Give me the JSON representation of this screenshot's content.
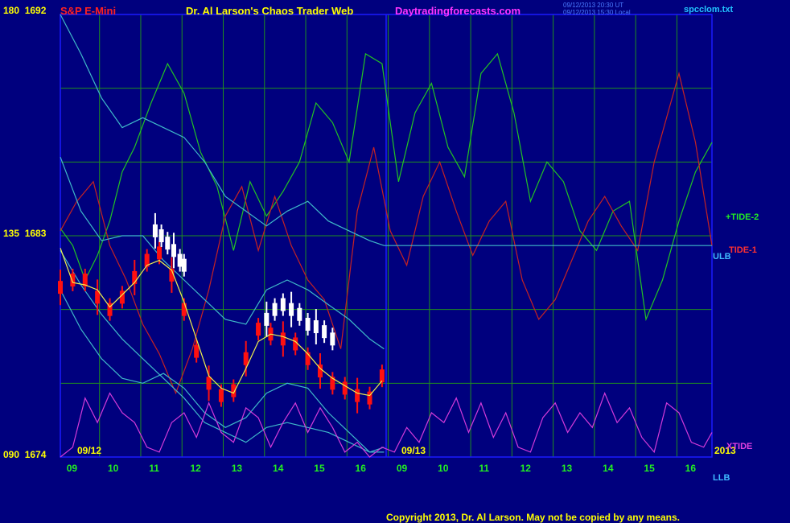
{
  "header": {
    "instrument": "S&P E-Mini",
    "title": "Dr. Al Larson's Chaos Trader Web",
    "site": "Daytradingforecasts.com",
    "stamp_line1": "09/12/2013 20:30 UT",
    "stamp_line2": "09/12/2013 15:30 Local",
    "file": "spcclom.txt"
  },
  "footer": {
    "copyright": "Copyright 2013, Dr. Al Larson. May not be copied by any means."
  },
  "colors": {
    "background": "#00007e",
    "grid": "#1f8f1f",
    "axis": "#1a1aff",
    "tide2": "#22c422",
    "tide1": "#c62222",
    "bands": "#3fb9c9",
    "xtide": "#d53ad9",
    "ma": "#f2f24a",
    "candle_red": "#ff1010",
    "candle_white": "#ffffff",
    "ylabel": "#ffff00",
    "xlabel": "#22ee22",
    "instrument": "#ff2020",
    "title": "#ffff00",
    "site": "#ff33ff",
    "file": "#22c4ff",
    "stamp": "#4a7cff",
    "copyright": "#ffff00"
  },
  "chart_data": {
    "type": "line",
    "y_left_ticks": [
      "180",
      "135",
      "090"
    ],
    "y_right_ticks": [
      "1692",
      "1683",
      "1674"
    ],
    "y_price_range": [
      1674,
      1692
    ],
    "x_ticks": [
      "09",
      "10",
      "11",
      "12",
      "13",
      "14",
      "15",
      "16",
      "09",
      "10",
      "11",
      "12",
      "13",
      "14",
      "15",
      "16"
    ],
    "date_labels": [
      "09/12",
      "09/13",
      "2013"
    ],
    "series_labels": [
      "+TIDE-2",
      "TIDE-1",
      "ULB",
      "XTIDE",
      "LLB"
    ],
    "series": [
      {
        "name": "+TIDE-2",
        "color_key": "tide2",
        "x": [
          0,
          0.3,
          0.6,
          0.9,
          1.2,
          1.5,
          1.8,
          2.2,
          2.6,
          3.0,
          3.4,
          3.8,
          4.2,
          4.6,
          5.0,
          5.4,
          5.8,
          6.2,
          6.6,
          7.0,
          7.4,
          7.8,
          8.2,
          8.6,
          9.0,
          9.4,
          9.8,
          10.2,
          10.6,
          11.0,
          11.4,
          11.8,
          12.2,
          12.6,
          13.0,
          13.4,
          13.8,
          14.2,
          14.6,
          15.0,
          15.4,
          15.8
        ],
        "y": [
          136.5,
          133,
          126,
          131,
          138,
          148,
          153,
          162,
          170,
          164,
          152,
          145,
          132,
          146,
          139,
          144,
          150,
          162,
          158,
          150,
          172,
          170,
          146,
          160,
          166,
          153,
          147,
          168,
          172,
          160,
          142,
          150,
          146,
          136,
          132,
          140,
          142,
          118,
          126,
          138,
          148,
          154
        ]
      },
      {
        "name": "TIDE-1",
        "color_key": "tide1",
        "x": [
          0,
          0.4,
          0.8,
          1.2,
          1.6,
          2.0,
          2.4,
          2.8,
          3.2,
          3.6,
          4.0,
          4.4,
          4.8,
          5.2,
          5.6,
          6.0,
          6.4,
          6.8,
          7.2,
          7.6,
          8.0,
          8.4,
          8.8,
          9.2,
          9.6,
          10.0,
          10.4,
          10.8,
          11.2,
          11.6,
          12.0,
          12.4,
          12.8,
          13.2,
          13.6,
          14.0,
          14.4,
          14.8,
          15.0,
          15.4,
          15.8
        ],
        "y": [
          136,
          142,
          146,
          133,
          126,
          117,
          111,
          103,
          112,
          124,
          139,
          145,
          132,
          143,
          133,
          126,
          122,
          112,
          140,
          153,
          136,
          129,
          143,
          150,
          140,
          131,
          138,
          142,
          126,
          118,
          122,
          130,
          138,
          143,
          137,
          132,
          150,
          162,
          168,
          154,
          133
        ]
      },
      {
        "name": "ULB",
        "color_key": "bands",
        "x": [
          0,
          0.5,
          1.0,
          1.5,
          2.0,
          2.5,
          3.0,
          3.5,
          4.0,
          4.5,
          5.0,
          5.5,
          6.0,
          6.5,
          7.0,
          7.5,
          7.85,
          7.9,
          8.5,
          9.0,
          9.5,
          10.0,
          10.5,
          11.0,
          11.5,
          12.0,
          12.5,
          13.0,
          13.5,
          14.0,
          14.5,
          15.0,
          15.5,
          15.8
        ],
        "y": [
          180,
          172,
          163,
          157,
          159,
          157,
          155,
          150,
          143,
          140,
          137,
          140,
          142,
          138,
          136,
          134,
          133,
          133,
          133,
          133,
          133,
          133,
          133,
          133,
          133,
          133,
          133,
          133,
          133,
          133,
          133,
          133,
          133,
          133
        ]
      },
      {
        "name": "ULB-inner",
        "color_key": "bands",
        "x": [
          0,
          0.5,
          1.0,
          1.5,
          2.0,
          2.5,
          3.0,
          3.5,
          4.0,
          4.5,
          5.0,
          5.5,
          6.0,
          6.5,
          7.0,
          7.5,
          7.85
        ],
        "y": [
          151,
          140,
          134,
          135,
          135,
          130,
          126,
          122,
          118,
          117,
          124,
          126,
          124,
          121,
          118,
          114,
          112
        ]
      },
      {
        "name": "LLB-inner",
        "color_key": "bands",
        "x": [
          0,
          0.5,
          1.0,
          1.5,
          2.0,
          2.5,
          3.0,
          3.5,
          4.0,
          4.5,
          5.0,
          5.5,
          6.0,
          6.5,
          7.0,
          7.5,
          7.85
        ],
        "y": [
          124,
          116,
          110,
          106,
          105,
          107,
          104,
          99,
          96,
          98,
          103,
          105,
          104,
          99,
          95,
          91,
          92
        ]
      },
      {
        "name": "LLB",
        "color_key": "bands",
        "x": [
          0,
          0.5,
          1.0,
          1.5,
          2.0,
          2.5,
          3.0,
          3.5,
          4.0,
          4.5,
          5.0,
          5.5,
          6.0,
          6.5,
          7.0,
          7.5,
          7.85
        ],
        "y": [
          132,
          125,
          119,
          114,
          110,
          106,
          102,
          97,
          95,
          93,
          96,
          97,
          96,
          95,
          93,
          91,
          91
        ]
      },
      {
        "name": "XTIDE",
        "color_key": "xtide",
        "x": [
          0,
          0.3,
          0.6,
          0.9,
          1.2,
          1.5,
          1.8,
          2.1,
          2.4,
          2.7,
          3.0,
          3.3,
          3.6,
          3.9,
          4.2,
          4.5,
          4.8,
          5.1,
          5.4,
          5.7,
          6.0,
          6.3,
          6.6,
          6.9,
          7.2,
          7.5,
          7.8,
          8.1,
          8.4,
          8.7,
          9.0,
          9.3,
          9.6,
          9.9,
          10.2,
          10.5,
          10.8,
          11.1,
          11.4,
          11.7,
          12.0,
          12.3,
          12.6,
          12.9,
          13.2,
          13.5,
          13.8,
          14.1,
          14.4,
          14.7,
          15.0,
          15.3,
          15.6,
          15.8
        ],
        "y": [
          90,
          92,
          102,
          97,
          103,
          99,
          97,
          92,
          91,
          97,
          99,
          94,
          101,
          95,
          93,
          100,
          98,
          92,
          97,
          101,
          95,
          100,
          96,
          91,
          93,
          90,
          92,
          91,
          96,
          93,
          99,
          97,
          102,
          95,
          101,
          94,
          99,
          92,
          91,
          98,
          101,
          95,
          99,
          96,
          103,
          97,
          100,
          94,
          91,
          101,
          99,
          93,
          92,
          95
        ]
      }
    ],
    "price_segments": [
      {
        "color_key": "candle_red",
        "x": [
          0,
          0.3,
          0.6,
          0.9,
          1.2,
          1.5,
          1.8,
          2.1,
          2.4,
          2.7,
          3.0,
          3.3,
          3.6,
          3.9,
          4.2,
          4.5,
          4.8,
          5.1,
          5.4,
          5.7,
          6.0,
          6.3,
          6.6,
          6.9,
          7.2,
          7.5,
          7.8
        ],
        "y": [
          1680.9,
          1681.2,
          1681.2,
          1680.5,
          1680.0,
          1680.5,
          1681.3,
          1682.0,
          1682.3,
          1681.4,
          1680.0,
          1678.3,
          1677.0,
          1676.5,
          1676.7,
          1678.0,
          1679.2,
          1679.0,
          1678.8,
          1678.6,
          1678.0,
          1677.5,
          1677.0,
          1676.8,
          1676.5,
          1676.4,
          1677.3
        ]
      },
      {
        "color_key": "candle_white",
        "x": [
          2.3,
          2.45,
          2.6,
          2.75,
          2.9,
          3.0
        ],
        "y": [
          1683.2,
          1683.0,
          1682.7,
          1682.4,
          1682.0,
          1681.8
        ]
      },
      {
        "color_key": "candle_white",
        "x": [
          5.0,
          5.2,
          5.4,
          5.6,
          5.8,
          6.0,
          6.2,
          6.4,
          6.6
        ],
        "y": [
          1679.6,
          1680.0,
          1680.2,
          1680.0,
          1679.8,
          1679.4,
          1679.3,
          1679.1,
          1678.8
        ]
      }
    ],
    "ma_line": {
      "color_key": "ma",
      "x": [
        0,
        0.3,
        0.6,
        0.9,
        1.2,
        1.5,
        1.8,
        2.1,
        2.4,
        2.7,
        3.0,
        3.3,
        3.6,
        3.9,
        4.2,
        4.5,
        4.8,
        5.1,
        5.4,
        5.7,
        6.0,
        6.3,
        6.6,
        6.9,
        7.2,
        7.5,
        7.8
      ],
      "y": [
        1682.5,
        1681.1,
        1681.0,
        1680.8,
        1680.1,
        1680.6,
        1681.1,
        1681.8,
        1682.0,
        1681.6,
        1680.3,
        1678.8,
        1677.3,
        1676.8,
        1676.6,
        1677.6,
        1678.7,
        1679.0,
        1678.9,
        1678.7,
        1678.2,
        1677.6,
        1677.2,
        1676.9,
        1676.6,
        1676.5,
        1677.1
      ]
    },
    "x_range": [
      0,
      15.8
    ],
    "y_range": [
      90,
      180
    ],
    "grid": true
  }
}
